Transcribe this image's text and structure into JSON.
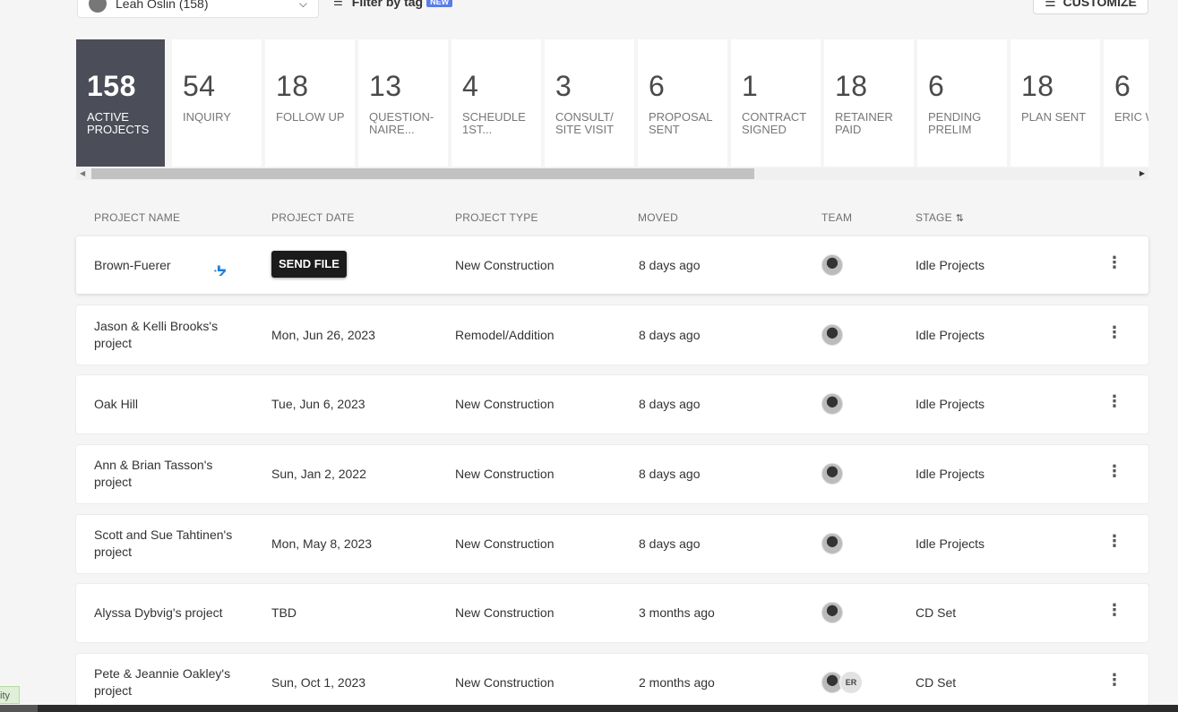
{
  "topbar": {
    "user_select": "Leah Oslin (158)",
    "filter_label": "Filter by tag",
    "new_badge": "NEW",
    "customize_label": "CUSTOMIZE"
  },
  "stages": [
    {
      "count": "158",
      "label": "ACTIVE PROJECTS",
      "active": true
    },
    {
      "count": "54",
      "label": "INQUIRY"
    },
    {
      "count": "18",
      "label": "FOLLOW UP"
    },
    {
      "count": "13",
      "label": "QUESTION-NAIRE..."
    },
    {
      "count": "4",
      "label": "SCHEUDLE 1ST..."
    },
    {
      "count": "3",
      "label": "CONSULT/ SITE VISIT"
    },
    {
      "count": "6",
      "label": "PROPOSAL SENT"
    },
    {
      "count": "1",
      "label": "CONTRACT SIGNED"
    },
    {
      "count": "18",
      "label": "RETAINER PAID"
    },
    {
      "count": "6",
      "label": "PENDING PRELIM"
    },
    {
      "count": "18",
      "label": "PLAN SENT"
    },
    {
      "count": "6",
      "label": "ERIC WORK"
    }
  ],
  "table": {
    "headers": {
      "name": "PROJECT NAME",
      "date": "PROJECT DATE",
      "type": "PROJECT TYPE",
      "moved": "MOVED",
      "team": "TEAM",
      "stage": "STAGE"
    },
    "send_file_label": "SEND FILE",
    "rows": [
      {
        "name": "Brown-Fuerer",
        "date": "",
        "type": "New Construction",
        "moved": "8 days ago",
        "stage": "Idle Projects"
      },
      {
        "name": "Jason & Kelli Brooks's project",
        "date": "Mon, Jun 26, 2023",
        "type": "Remodel/Addition",
        "moved": "8 days ago",
        "stage": "Idle Projects"
      },
      {
        "name": "Oak Hill",
        "date": "Tue, Jun 6, 2023",
        "type": "New Construction",
        "moved": "8 days ago",
        "stage": "Idle Projects"
      },
      {
        "name": "Ann & Brian Tasson's project",
        "date": "Sun, Jan 2, 2022",
        "type": "New Construction",
        "moved": "8 days ago",
        "stage": "Idle Projects"
      },
      {
        "name": "Scott and Sue Tahtinen's project",
        "date": "Mon, May 8, 2023",
        "type": "New Construction",
        "moved": "8 days ago",
        "stage": "Idle Projects"
      },
      {
        "name": "Alyssa Dybvig's project",
        "date": "TBD",
        "type": "New Construction",
        "moved": "3 months ago",
        "stage": "CD Set"
      },
      {
        "name": "Pete & Jeannie Oakley's project",
        "date": "Sun, Oct 1, 2023",
        "type": "New Construction",
        "moved": "2 months ago",
        "stage": "CD Set",
        "extra_member": "ER"
      }
    ]
  },
  "side_tag": "ity"
}
